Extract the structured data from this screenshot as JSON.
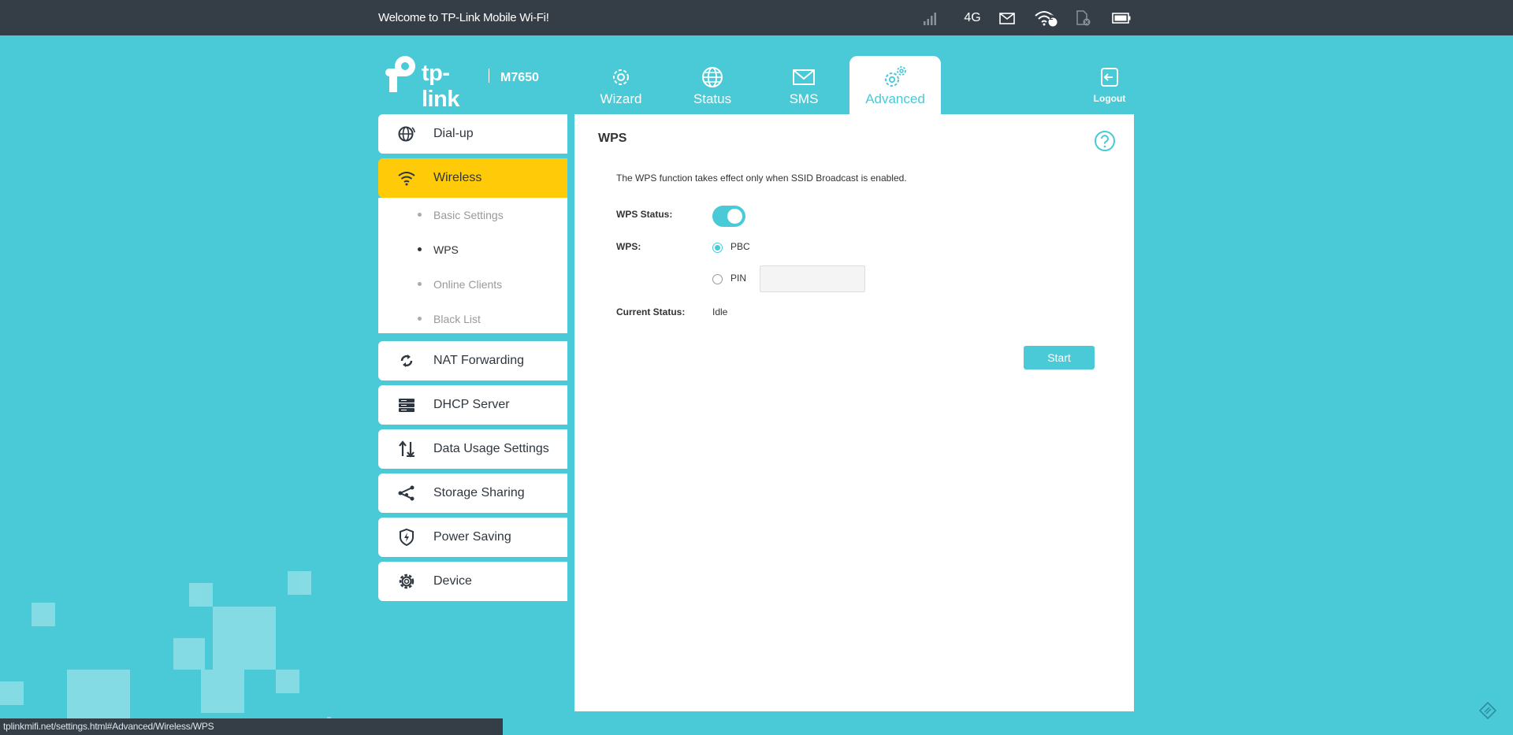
{
  "topbar": {
    "welcome": "Welcome to TP-Link Mobile Wi-Fi!",
    "network_type": "4G",
    "wifi_clients": "2",
    "icons": [
      "signal-icon",
      "mail-icon",
      "wifi-icon",
      "sim-card-icon",
      "battery-icon"
    ]
  },
  "header": {
    "logo": "tp-link",
    "model": "M7650",
    "logout_label": "Logout"
  },
  "nav": {
    "tabs": [
      {
        "label": "Wizard",
        "icon": "gear-icon"
      },
      {
        "label": "Status",
        "icon": "globe-icon"
      },
      {
        "label": "SMS",
        "icon": "mail-icon"
      },
      {
        "label": "Advanced",
        "icon": "gears-icon",
        "active": true
      }
    ]
  },
  "sidebar": {
    "items": [
      {
        "label": "Dial-up",
        "icon": "globe-dial-icon"
      },
      {
        "label": "Wireless",
        "icon": "wifi-icon",
        "active": true
      },
      {
        "label": "NAT Forwarding",
        "icon": "nat-icon"
      },
      {
        "label": "DHCP Server",
        "icon": "server-icon"
      },
      {
        "label": "Data Usage Settings",
        "icon": "up-down-arrows-icon"
      },
      {
        "label": "Storage Sharing",
        "icon": "share-icon"
      },
      {
        "label": "Power Saving",
        "icon": "shield-bolt-icon"
      },
      {
        "label": "Device",
        "icon": "gear-icon"
      }
    ],
    "wireless_sub": [
      {
        "label": "Basic Settings"
      },
      {
        "label": "WPS",
        "active": true
      },
      {
        "label": "Online Clients"
      },
      {
        "label": "Black List"
      }
    ]
  },
  "content": {
    "title": "WPS",
    "description": "The WPS function takes effect only when SSID Broadcast is enabled.",
    "wps_status_label": "WPS Status:",
    "wps_status_on": true,
    "wps_label": "WPS:",
    "pbc_label": "PBC",
    "pin_label": "PIN",
    "pin_value": "",
    "selected_mode": "PBC",
    "current_status_label": "Current Status:",
    "current_status_value": "Idle",
    "start_label": "Start"
  },
  "url_bar": "tplinkmifi.net/settings.html#Advanced/Wireless/WPS",
  "colors": {
    "accent": "#4ac9d6",
    "topbar": "#353e46",
    "active_menu": "#ffca08"
  }
}
